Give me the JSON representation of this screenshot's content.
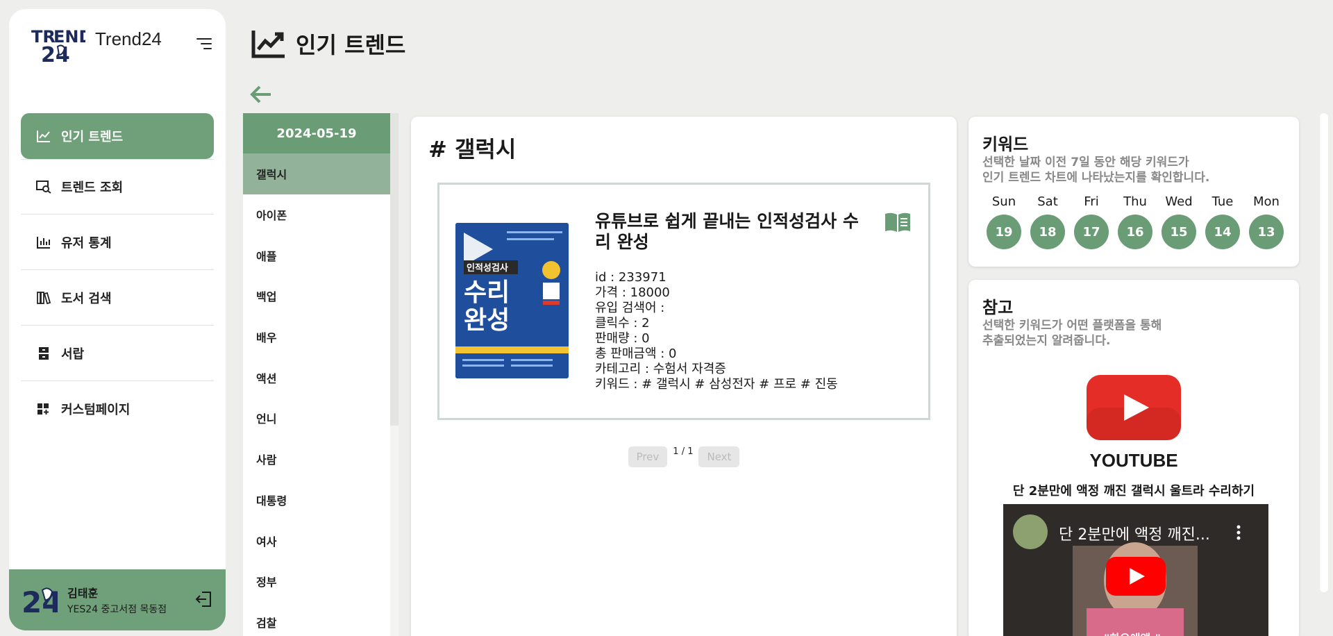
{
  "app": {
    "name": "Trend24"
  },
  "nav": {
    "items": [
      {
        "label": "인기 트렌드",
        "icon": "line-chart-icon",
        "active": true
      },
      {
        "label": "트렌드 조회",
        "icon": "search-chart-icon",
        "active": false
      },
      {
        "label": "유저 통계",
        "icon": "bar-chart-icon",
        "active": false
      },
      {
        "label": "도서 검색",
        "icon": "books-icon",
        "active": false
      },
      {
        "label": "서랍",
        "icon": "drawer-icon",
        "active": false
      },
      {
        "label": "커스텀페이지",
        "icon": "dashboard-add-icon",
        "active": false
      }
    ]
  },
  "user": {
    "name": "김태훈",
    "store": "YES24 중고서점 목동점"
  },
  "page": {
    "title": "인기 트렌드"
  },
  "keywords": {
    "date": "2024-05-19",
    "items": [
      "갤럭시",
      "아이폰",
      "애플",
      "백업",
      "배우",
      "액션",
      "언니",
      "사람",
      "대통령",
      "여사",
      "정부",
      "검찰"
    ],
    "active_index": 0
  },
  "detail": {
    "heading": "# 갤럭시",
    "book": {
      "title": "유튜브로 쉽게 끝내는 인적성검사 수리 완성",
      "cover_text_1": "인적성검사",
      "cover_text_2": "수리",
      "cover_text_3": "완성",
      "meta": [
        "id : 233971",
        "가격 : 18000",
        "유입 검색어 :",
        "클릭수 : 2",
        "판매량 : 0",
        "총 판매금액 : 0",
        "카테고리 : 수험서 자격증",
        "키워드 : # 갤럭시 # 삼성전자 # 프로 # 진동"
      ]
    },
    "pager": {
      "prev": "Prev",
      "status": "1 / 1",
      "next": "Next"
    }
  },
  "keyword_card": {
    "title": "키워드",
    "desc_line1": "선택한 날짜 이전 7일 동안 해당 키워드가",
    "desc_line2": "인기 트렌드 차트에 나타났는지를 확인합니다.",
    "days": [
      {
        "name": "Sun",
        "num": "19"
      },
      {
        "name": "Sat",
        "num": "18"
      },
      {
        "name": "Fri",
        "num": "17"
      },
      {
        "name": "Thu",
        "num": "16"
      },
      {
        "name": "Wed",
        "num": "15"
      },
      {
        "name": "Tue",
        "num": "14"
      },
      {
        "name": "Mon",
        "num": "13"
      }
    ]
  },
  "reference_card": {
    "title": "참고",
    "desc_line1": "선택한 키워드가 어떤 플랫폼을 통해",
    "desc_line2": "추출되었는지 알려줍니다.",
    "platform": "YOUTUBE",
    "video_title": "단 2분만에 액정 깨진 갤럭시 울트라 수리하기",
    "video_inner_title": "단 2분만에 액정 깨진...",
    "video_caption": "\"하으애앵:\""
  },
  "colors": {
    "accent": "#6fa07a",
    "accent_dark": "#6a9c75",
    "active_item": "#92b39a",
    "youtube_red": "#e52d27"
  }
}
